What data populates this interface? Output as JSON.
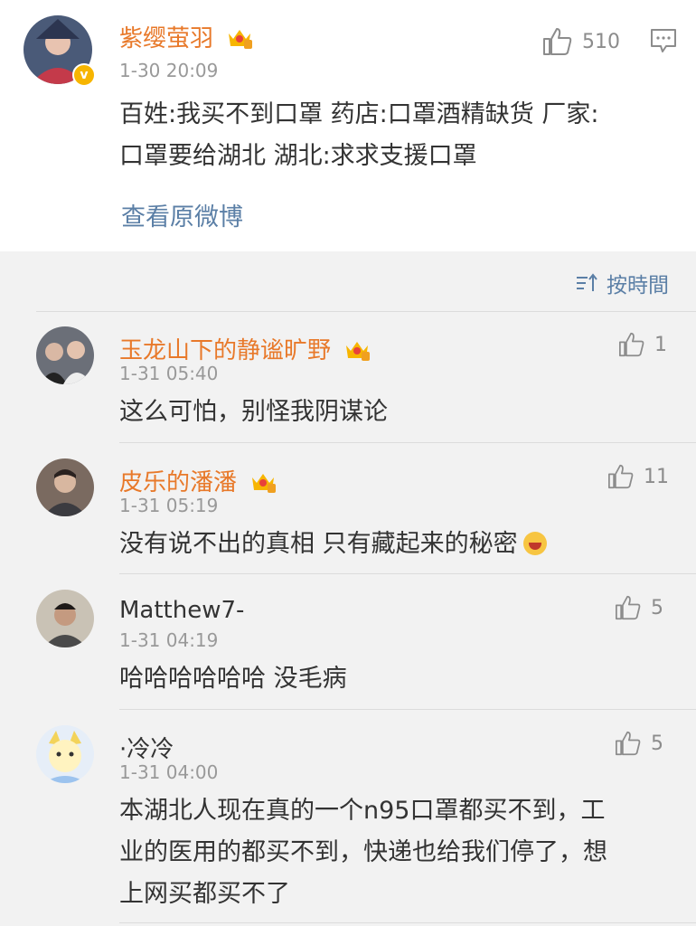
{
  "post": {
    "username": "紫缨萤羽",
    "verified_mark": "v",
    "time": "1-30 20:09",
    "likes": "510",
    "text_line1": "百姓:我买不到口罩 药店:口罩酒精缺货 厂家:",
    "text_line2": "口罩要给湖北 湖北:求求支援口罩",
    "view_original": "查看原微博"
  },
  "sort": {
    "label": "按時間"
  },
  "comments": [
    {
      "username": "玉龙山下的静谧旷野",
      "time": "1-31 05:40",
      "likes": "1",
      "text": "这么可怕，别怪我阴谋论"
    },
    {
      "username": "皮乐的潘潘",
      "time": "1-31 05:19",
      "likes": "11",
      "text": "没有说不出的真相 只有藏起来的秘密"
    },
    {
      "username": "Matthew7-",
      "time": "1-31 04:19",
      "likes": "5",
      "text": "哈哈哈哈哈哈 没毛病"
    },
    {
      "username": "·冷冷",
      "time": "1-31 04:00",
      "likes": "5",
      "text_line1": "本湖北人现在真的一个n95口罩都买不到，工",
      "text_line2": "业的医用的都买不到，快递也给我们停了，想",
      "text_line3": "上网买都买不了"
    }
  ],
  "icons": {
    "like": "thumbs-up-icon",
    "comment": "comment-icon",
    "member": "crown-icon",
    "sort": "sort-icon",
    "emoji": "laugh-cry-emoji"
  },
  "colors": {
    "username": "#e8792a",
    "link": "#5b7fa6",
    "meta": "#999999",
    "background": "#f2f2f2"
  }
}
